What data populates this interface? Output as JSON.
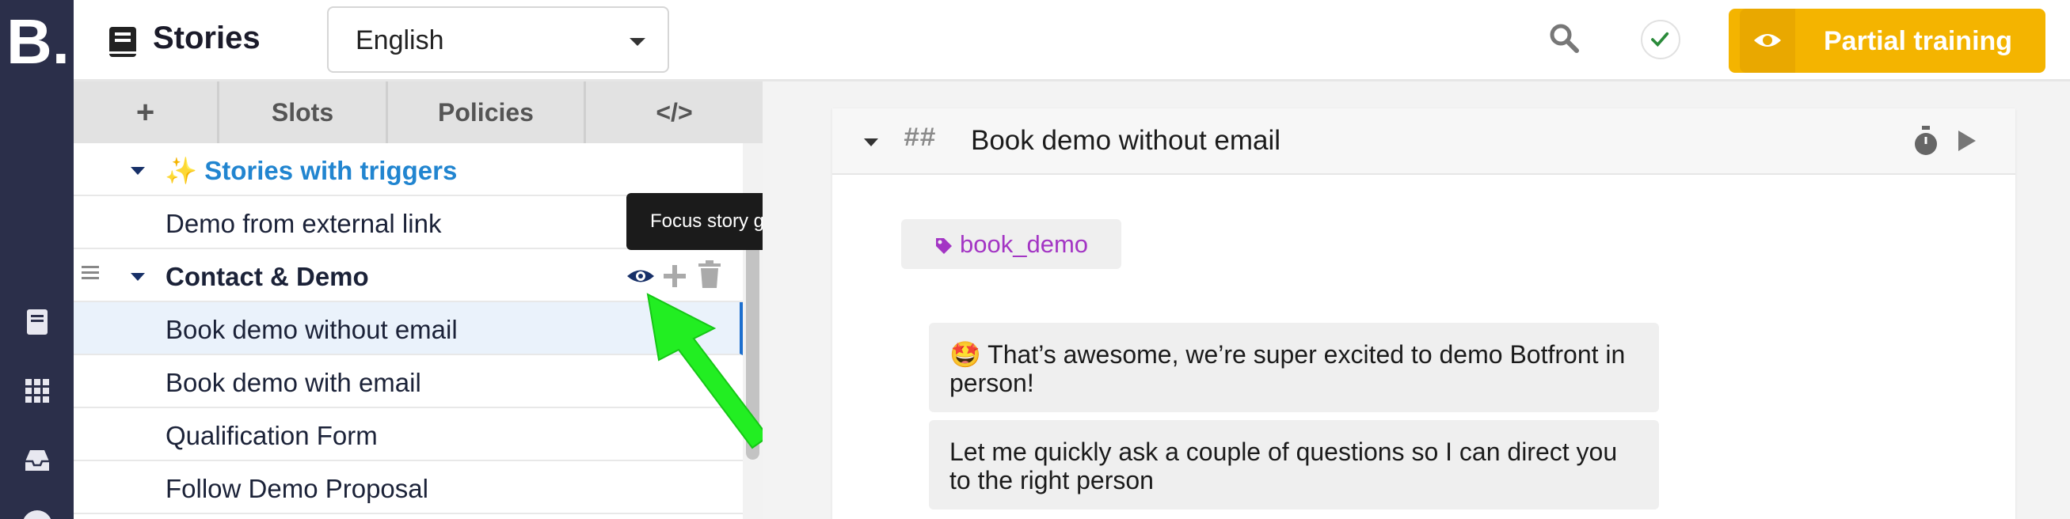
{
  "brand": {
    "logo_text": "B."
  },
  "header": {
    "title": "Stories",
    "language": {
      "selected": "English"
    },
    "train_button": {
      "label": "Partial training"
    }
  },
  "sidebar_tabs": [
    {
      "label": "+"
    },
    {
      "label": "Slots"
    },
    {
      "label": "Policies"
    },
    {
      "label": "</>"
    }
  ],
  "tree": {
    "groups": [
      {
        "label": "Stories with triggers",
        "emoji": "✨",
        "stories": [
          "Demo from external link"
        ]
      },
      {
        "label": "Contact & Demo",
        "stories": [
          "Book demo without email",
          "Book demo with email",
          "Qualification Form",
          "Follow Demo Proposal"
        ]
      }
    ]
  },
  "tooltip": {
    "text": "Focus story group"
  },
  "story": {
    "hashes": "##",
    "title": "Book demo without email",
    "intent": "book_demo",
    "messages": [
      "🤩 That’s awesome, we’re super excited to demo Botfront in person!",
      "Let me quickly ask a couple of questions so I can direct you to the right person"
    ]
  },
  "colors": {
    "rail_bg": "#2b2f4a",
    "accent_blue": "#2185d0",
    "train_yellow": "#f4b400",
    "intent_purple": "#a335c4",
    "arrow_green": "#22ee22"
  }
}
